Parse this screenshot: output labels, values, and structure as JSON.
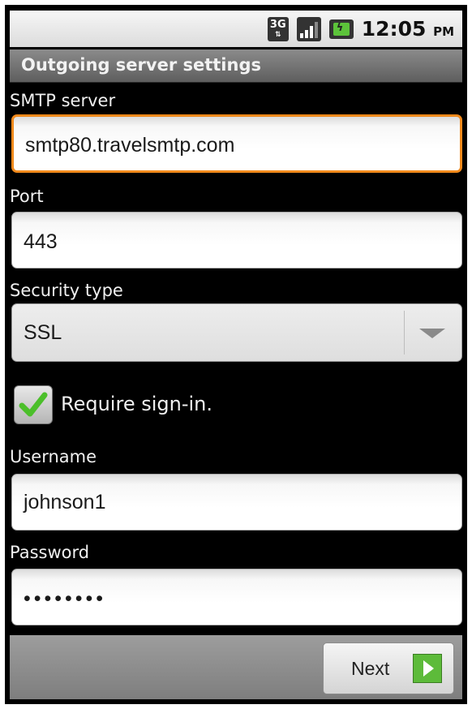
{
  "status_bar": {
    "network": "3G",
    "time": "12:05",
    "ampm": "PM",
    "icons": [
      "network-3g-icon",
      "signal-icon",
      "battery-icon"
    ]
  },
  "title": "Outgoing server settings",
  "smtp": {
    "label": "SMTP server",
    "value": "smtp80.travelsmtp.com"
  },
  "port": {
    "label": "Port",
    "value": "443"
  },
  "security": {
    "label": "Security type",
    "value": "SSL"
  },
  "require_signin": {
    "label": "Require sign-in.",
    "checked": true
  },
  "username": {
    "label": "Username",
    "value": "johnson1"
  },
  "password": {
    "label": "Password",
    "value": "••••••••"
  },
  "next_label": "Next",
  "colors": {
    "focus": "#f28a1c",
    "accent_green": "#5dbb3a"
  }
}
